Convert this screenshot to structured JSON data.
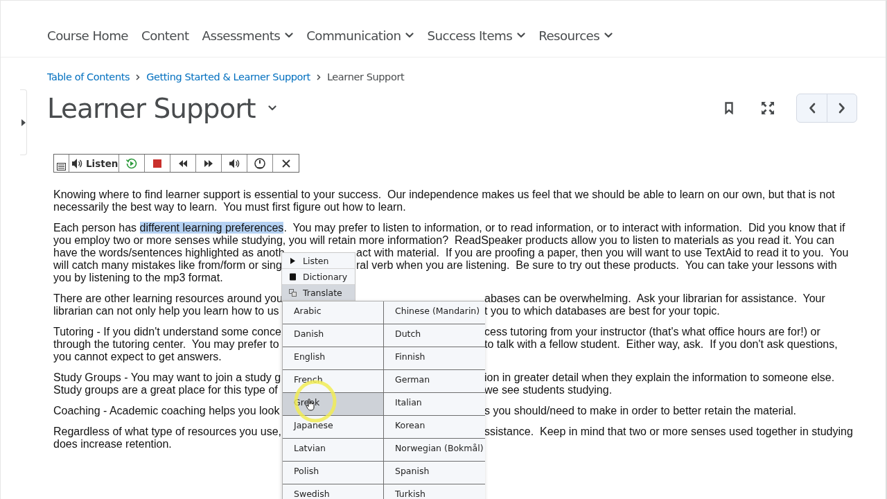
{
  "nav": [
    {
      "label": "Course Home",
      "dropdown": false
    },
    {
      "label": "Content",
      "dropdown": false
    },
    {
      "label": "Assessments",
      "dropdown": true
    },
    {
      "label": "Communication",
      "dropdown": true
    },
    {
      "label": "Success Items",
      "dropdown": true
    },
    {
      "label": "Resources",
      "dropdown": true
    }
  ],
  "breadcrumbs": [
    {
      "label": "Table of Contents",
      "kind": "link"
    },
    {
      "label": "Getting Started & Learner Support",
      "kind": "link"
    },
    {
      "label": "Learner Support",
      "kind": "current"
    }
  ],
  "title": "Learner Support",
  "toolbar": {
    "listen_label": "Listen"
  },
  "paragraphs": [
    {
      "lines": [
        {
          "text": "Knowing where to find learner support is essential to your success.  Our independence makes us feel that we should be able to learn on our own, but that is not"
        },
        {
          "text": "necessarily the best way to learn.  You must first figure out how to learn."
        }
      ]
    },
    {
      "lines": [
        {
          "parts": [
            {
              "text": "Each person has ",
              "highlighted": false
            },
            {
              "text": "different learning preferences",
              "highlighted": true
            },
            {
              "text": ".  You may prefer to listen to information, or to read information, or to interact with information.  Did you know that if",
              "highlighted": false
            }
          ]
        },
        {
          "text": "you employ two or more senses while studying, you will retain more information?  ReadSpeaker products allow you to listen to materials as you read it. You can"
        },
        {
          "left": "have the words/sentences highlighted as anoth",
          "right": "act with material.  If you are proofing a paper, then you will want to use TextAid to read it to you.  You"
        },
        {
          "left": "will catch many mistakes like from/form or sing",
          "right": "ral verb when you are listening.  Be sure to try out these products.  You can take your lessons with"
        },
        {
          "text": "you by listening to the mp3 format."
        }
      ]
    },
    {
      "lines": [
        {
          "left": "There are other learning resources around you",
          "right": "abases can be overwhelming.  Ask your librarian for assistance.  Your"
        },
        {
          "left": "librarian can not only help you learn how to us",
          "right": "t you to which databases are best for your topic."
        }
      ]
    },
    {
      "lines": [
        {
          "left": "Tutoring - If you didn't understand some conce",
          "right": "cess tutoring from your instructor (that's what office hours are for!) or"
        },
        {
          "left": "through the tutoring center.  You may prefer to",
          "right": "to talk with a fellow student.  Either way, ask.  If you don't ask questions,"
        },
        {
          "text": "you cannot expect to get answers."
        }
      ]
    },
    {
      "lines": [
        {
          "left": "Study Groups - You may want to join a study g",
          "right": "ion in greater detail when they explain the information to someone else."
        },
        {
          "left": "Study groups are a great place for this type of",
          "right": "we see students studying."
        }
      ]
    },
    {
      "lines": [
        {
          "left": "Coaching - Academic coaching helps you look",
          "right": "s you should/need to make in order to better retain the material."
        }
      ]
    },
    {
      "lines": [
        {
          "left": "Regardless of what type of resources you use,",
          "right": "ssistance.  Keep in mind that two or more senses used together in studying"
        },
        {
          "text": "does increase retention."
        }
      ]
    }
  ],
  "context_menu": [
    {
      "label": "Listen",
      "kind": "listen",
      "selected": false
    },
    {
      "label": "Dictionary",
      "kind": "dictionary",
      "selected": false
    },
    {
      "label": "Translate",
      "kind": "translate",
      "selected": true
    }
  ],
  "languages": [
    {
      "label": "Arabic",
      "selected": false
    },
    {
      "label": "Chinese (Mandarin)",
      "selected": false
    },
    {
      "label": "Danish",
      "selected": false
    },
    {
      "label": "Dutch",
      "selected": false
    },
    {
      "label": "English",
      "selected": false
    },
    {
      "label": "Finnish",
      "selected": false
    },
    {
      "label": "French",
      "selected": false
    },
    {
      "label": "German",
      "selected": false
    },
    {
      "label": "Greek",
      "selected": true
    },
    {
      "label": "Italian",
      "selected": false
    },
    {
      "label": "Japanese",
      "selected": false
    },
    {
      "label": "Korean",
      "selected": false
    },
    {
      "label": "Latvian",
      "selected": false
    },
    {
      "label": "Norwegian (Bokmål)",
      "selected": false
    },
    {
      "label": "Polish",
      "selected": false
    },
    {
      "label": "Spanish",
      "selected": false
    },
    {
      "label": "Swedish",
      "selected": false
    },
    {
      "label": "Turkish",
      "selected": false
    }
  ]
}
